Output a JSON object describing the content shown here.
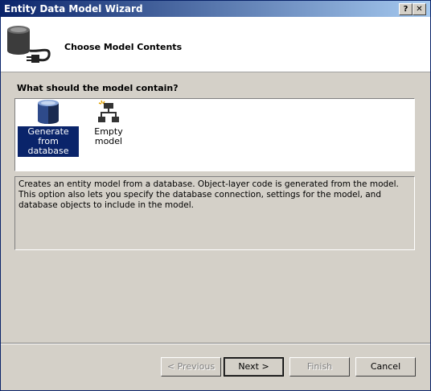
{
  "window": {
    "title": "Entity Data Model Wizard",
    "help_button": "?",
    "close_button": "✕"
  },
  "header": {
    "title": "Choose Model Contents"
  },
  "question": "What should the model contain?",
  "options": [
    {
      "label_line1": "Generate from",
      "label_line2": "database",
      "selected": true
    },
    {
      "label_line1": "Empty model",
      "label_line2": "",
      "selected": false
    }
  ],
  "description": "Creates an entity model from a database. Object-layer code is generated from the model. This option also lets you specify the database connection, settings for the model, and database objects to include in the model.",
  "buttons": {
    "previous": "< Previous",
    "next": "Next >",
    "finish": "Finish",
    "cancel": "Cancel"
  },
  "colors": {
    "selection": "#0a246a",
    "dialog_bg": "#d4d0c8"
  }
}
